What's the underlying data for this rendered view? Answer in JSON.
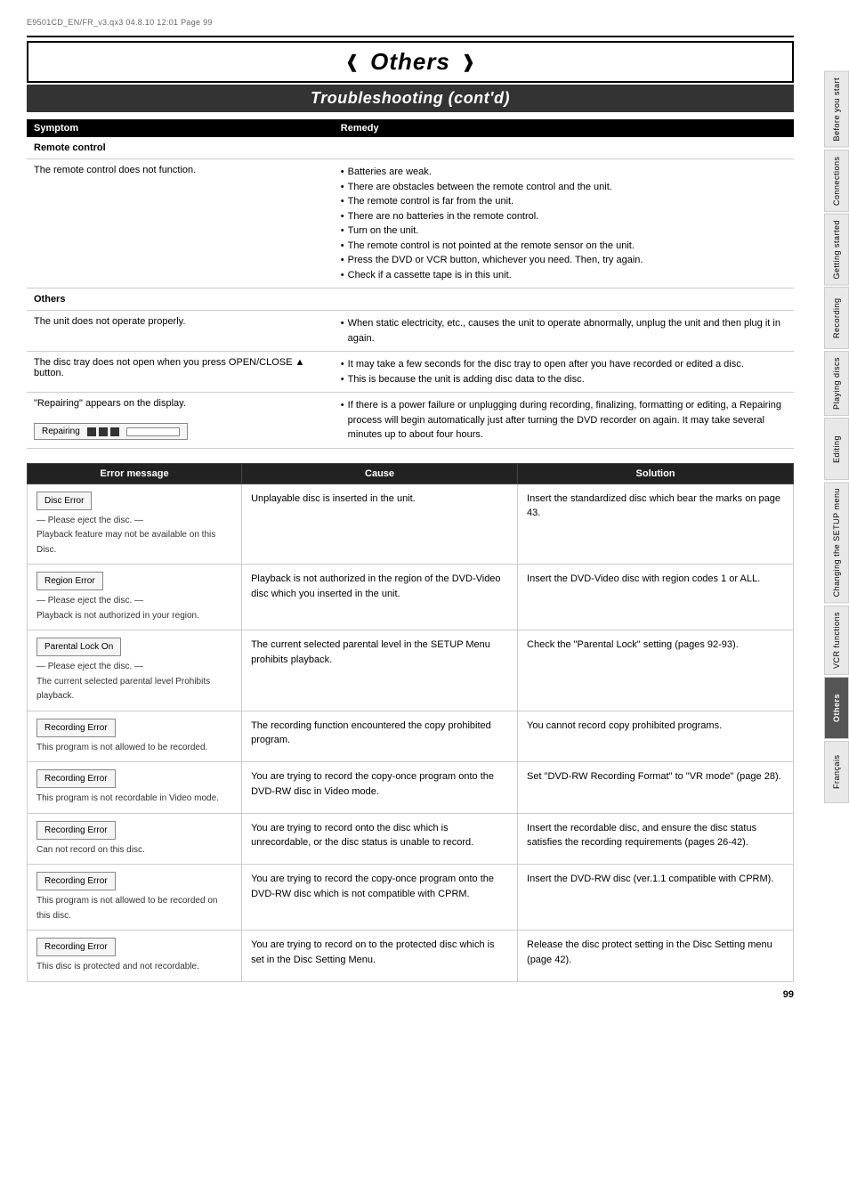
{
  "file_info": "E9501CD_EN/FR_v3.qx3   04.8.10   12:01   Page 99",
  "title": "Others",
  "subtitle": "Troubleshooting (cont'd)",
  "symptom_header": "Symptom",
  "remedy_header": "Remedy",
  "sections": [
    {
      "category": "Remote control",
      "rows": [
        {
          "symptom": "The remote control does not function.",
          "remedies": [
            "Batteries are weak.",
            "There are obstacles between the remote control and the unit.",
            "The remote control is far from the unit.",
            "There are no batteries in the remote control.",
            "Turn on the unit.",
            "The remote control is not pointed at the remote sensor on the unit.",
            "Press the DVD or VCR button, whichever you need. Then, try again.",
            "Check if a cassette tape is in this unit."
          ]
        }
      ]
    },
    {
      "category": "Others",
      "rows": [
        {
          "symptom": "The unit does not operate properly.",
          "remedies": [
            "When static electricity, etc., causes the unit to operate abnormally, unplug the unit and then plug it in again."
          ]
        },
        {
          "symptom": "The disc tray does not open when you press OPEN/CLOSE ▲ button.",
          "remedies": [
            "It may take a few seconds for the disc tray to open after you have recorded or edited a disc.",
            "This is because the unit is adding disc data to the disc."
          ]
        },
        {
          "symptom": "\"Repairing\" appears on the display.",
          "remedies": [
            "If there is a power failure or unplugging during recording, finalizing, formatting or editing, a Repairing process will begin automatically just after turning the DVD recorder on again. It may take several minutes up to about four hours."
          ],
          "has_display": true,
          "display_text": "Repairing"
        }
      ]
    }
  ],
  "error_table": {
    "headers": [
      "Error message",
      "Cause",
      "Solution"
    ],
    "rows": [
      {
        "error_box": "Disc Error",
        "error_sub1": "— Please eject the disc. —",
        "error_sub2": "Playback feature may not be available on this Disc.",
        "cause": "Unplayable disc is inserted in the unit.",
        "solution": "Insert the standardized disc which bear the marks on page 43."
      },
      {
        "error_box": "Region Error",
        "error_sub1": "— Please eject the disc. —",
        "error_sub2": "Playback is not authorized in your region.",
        "cause": "Playback is not authorized in the region of the DVD-Video disc which you inserted in the unit.",
        "solution": "Insert the DVD-Video disc with region codes 1 or ALL."
      },
      {
        "error_box": "Parental Lock On",
        "error_sub1": "— Please eject the disc. —",
        "error_sub2": "The current selected parental level Prohibits playback.",
        "cause": "The current selected parental level in the SETUP Menu prohibits playback.",
        "solution": "Check the \"Parental Lock\" setting (pages 92-93)."
      },
      {
        "error_box": "Recording Error",
        "error_sub1": "This program is not allowed",
        "error_sub2": "to be recorded.",
        "cause": "The recording function encountered the copy prohibited program.",
        "solution": "You cannot record copy prohibited programs."
      },
      {
        "error_box": "Recording Error",
        "error_sub1": "This program is not",
        "error_sub2": "recordable in Video mode.",
        "cause": "You are trying to record the copy-once program onto the DVD-RW disc in Video mode.",
        "solution": "Set \"DVD-RW Recording Format\" to \"VR mode\" (page 28)."
      },
      {
        "error_box": "Recording Error",
        "error_sub1": "Can not record on this disc.",
        "error_sub2": "",
        "cause": "You are trying to record onto the disc which is unrecordable, or the disc status is unable to record.",
        "solution": "Insert the recordable disc, and ensure the disc status satisfies the recording requirements (pages 26-42)."
      },
      {
        "error_box": "Recording Error",
        "error_sub1": "This program is not allowed to",
        "error_sub2": "be recorded on this disc.",
        "cause": "You are trying to record the copy-once program onto the DVD-RW disc which is not compatible with CPRM.",
        "solution": "Insert the DVD-RW disc (ver.1.1 compatible with CPRM)."
      },
      {
        "error_box": "Recording Error",
        "error_sub1": "This disc is protected and not",
        "error_sub2": "recordable.",
        "cause": "You are trying to record on to the protected disc which is set in the Disc Setting Menu.",
        "solution": "Release the disc protect setting in the Disc Setting menu (page 42)."
      }
    ]
  },
  "right_tabs": [
    {
      "label": "Before you start",
      "active": false
    },
    {
      "label": "Connections",
      "active": false
    },
    {
      "label": "Getting started",
      "active": false
    },
    {
      "label": "Recording",
      "active": false
    },
    {
      "label": "Playing discs",
      "active": false
    },
    {
      "label": "Editing",
      "active": false
    },
    {
      "label": "Changing the SETUP menu",
      "active": false
    },
    {
      "label": "VCR functions",
      "active": false
    },
    {
      "label": "Others",
      "active": true
    },
    {
      "label": "Français",
      "active": false
    }
  ],
  "page_number": "99"
}
